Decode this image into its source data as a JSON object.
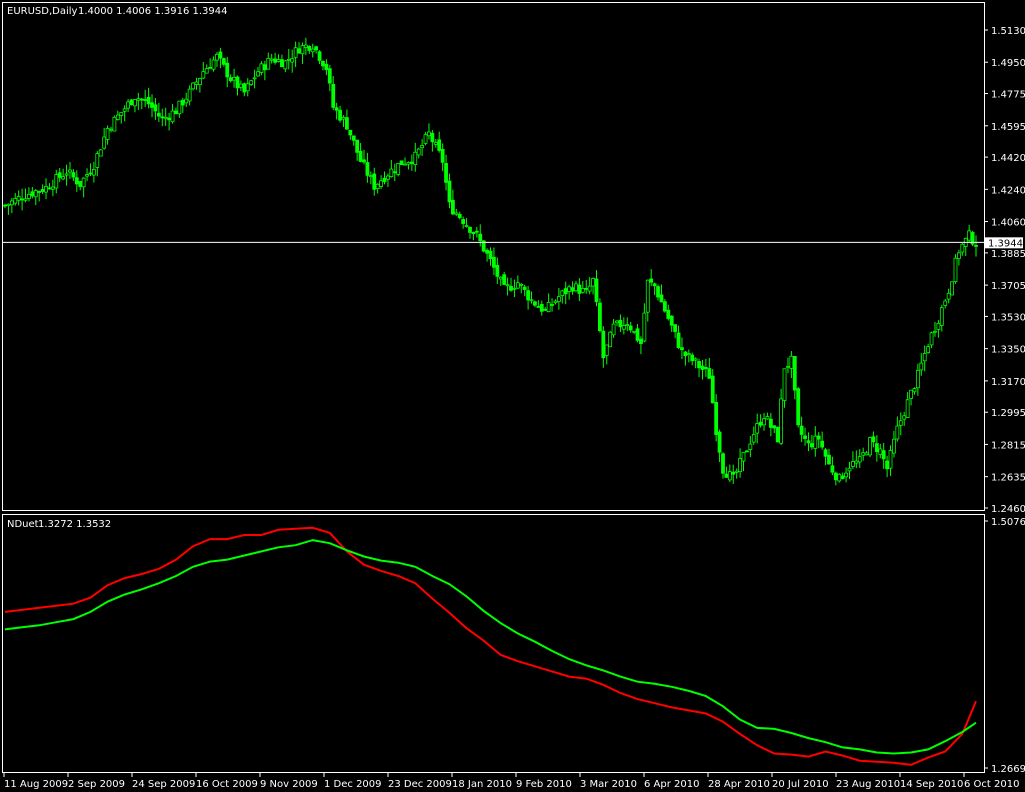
{
  "main_panel": {
    "header": {
      "symbol_tf": "EURUSD,Daily",
      "ohlc": "1.4000 1.4006 1.3916 1.3944"
    },
    "current_price_label": "1.3944"
  },
  "indicator_panel": {
    "header": {
      "name": "NDuet",
      "values": "1.3272 1.3532"
    }
  },
  "x_axis_labels": [
    "11 Aug 2009",
    "2 Sep 2009",
    "24 Sep 2009",
    "16 Oct 2009",
    "9 Nov 2009",
    "1 Dec 2009",
    "23 Dec 2009",
    "18 Jan 2010",
    "9 Feb 2010",
    "3 Mar 2010",
    "6 Apr 2010",
    "28 Apr 2010",
    "20 Jul 2010",
    "23 Aug 2010",
    "14 Sep 2010",
    "6 Oct 2010"
  ],
  "colors": {
    "background": "#000000",
    "candle": "#00ff00",
    "frame": "#ffffff",
    "fast_line": "#ff0000",
    "slow_line": "#00ff00"
  },
  "chart_data": [
    {
      "type": "candlestick",
      "title": "EURUSD,Daily",
      "y_ticks": [
        1.513,
        1.495,
        1.4775,
        1.4595,
        1.442,
        1.424,
        1.406,
        1.3885,
        1.3705,
        1.353,
        1.335,
        1.317,
        1.2995,
        1.2815,
        1.2635,
        1.246
      ],
      "ylim": [
        1.246,
        1.513
      ],
      "grid": false,
      "current_price": 1.3944,
      "close_path": [
        [
          0,
          1.415
        ],
        [
          6,
          1.421
        ],
        [
          12,
          1.425
        ],
        [
          18,
          1.434
        ],
        [
          22,
          1.427
        ],
        [
          26,
          1.438
        ],
        [
          30,
          1.458
        ],
        [
          34,
          1.467
        ],
        [
          38,
          1.476
        ],
        [
          42,
          1.472
        ],
        [
          46,
          1.463
        ],
        [
          50,
          1.468
        ],
        [
          54,
          1.478
        ],
        [
          58,
          1.49
        ],
        [
          62,
          1.498
        ],
        [
          66,
          1.486
        ],
        [
          70,
          1.478
        ],
        [
          74,
          1.49
        ],
        [
          78,
          1.497
        ],
        [
          82,
          1.495
        ],
        [
          86,
          1.503
        ],
        [
          90,
          1.505
        ],
        [
          94,
          1.492
        ],
        [
          96,
          1.47
        ],
        [
          100,
          1.46
        ],
        [
          104,
          1.44
        ],
        [
          108,
          1.426
        ],
        [
          112,
          1.433
        ],
        [
          116,
          1.439
        ],
        [
          120,
          1.442
        ],
        [
          124,
          1.455
        ],
        [
          128,
          1.44
        ],
        [
          130,
          1.415
        ],
        [
          134,
          1.407
        ],
        [
          138,
          1.398
        ],
        [
          142,
          1.384
        ],
        [
          146,
          1.368
        ],
        [
          150,
          1.372
        ],
        [
          154,
          1.362
        ],
        [
          158,
          1.356
        ],
        [
          162,
          1.364
        ],
        [
          166,
          1.37
        ],
        [
          170,
          1.366
        ],
        [
          172,
          1.373
        ],
        [
          175,
          1.33
        ],
        [
          178,
          1.347
        ],
        [
          182,
          1.35
        ],
        [
          186,
          1.338
        ],
        [
          188,
          1.372
        ],
        [
          190,
          1.37
        ],
        [
          194,
          1.352
        ],
        [
          198,
          1.333
        ],
        [
          202,
          1.327
        ],
        [
          206,
          1.32
        ],
        [
          208,
          1.29
        ],
        [
          210,
          1.268
        ],
        [
          213,
          1.262
        ],
        [
          216,
          1.275
        ],
        [
          219,
          1.288
        ],
        [
          222,
          1.298
        ],
        [
          226,
          1.285
        ],
        [
          228,
          1.325
        ],
        [
          230,
          1.328
        ],
        [
          232,
          1.29
        ],
        [
          235,
          1.281
        ],
        [
          238,
          1.285
        ],
        [
          241,
          1.27
        ],
        [
          244,
          1.262
        ],
        [
          247,
          1.27
        ],
        [
          250,
          1.272
        ],
        [
          253,
          1.283
        ],
        [
          256,
          1.278
        ],
        [
          258,
          1.268
        ],
        [
          261,
          1.29
        ],
        [
          264,
          1.305
        ],
        [
          267,
          1.32
        ],
        [
          270,
          1.338
        ],
        [
          273,
          1.352
        ],
        [
          276,
          1.368
        ],
        [
          279,
          1.39
        ],
        [
          282,
          1.398
        ],
        [
          284,
          1.394
        ]
      ]
    },
    {
      "type": "line",
      "title": "NDuet",
      "y_ticks": [
        1.5076,
        1.2669
      ],
      "ylim": [
        1.2669,
        1.5076
      ],
      "last_values": [
        1.3272,
        1.3532
      ],
      "series": [
        {
          "color": "#ff0000",
          "x": [
            0,
            5,
            10,
            15,
            20,
            25,
            30,
            35,
            40,
            45,
            50,
            55,
            60,
            65,
            70,
            75,
            80,
            85,
            90,
            95,
            100,
            105,
            110,
            115,
            120,
            125,
            130,
            135,
            140,
            145,
            150,
            155,
            160,
            165,
            170,
            175,
            180,
            185,
            190,
            195,
            200,
            205,
            210,
            215,
            220,
            225,
            230,
            235,
            240,
            245,
            250,
            255,
            260,
            265,
            270,
            275,
            280,
            284
          ],
          "values": [
            1.419,
            1.421,
            1.423,
            1.425,
            1.427,
            1.433,
            1.445,
            1.452,
            1.456,
            1.461,
            1.47,
            1.483,
            1.49,
            1.49,
            1.494,
            1.494,
            1.499,
            1.5,
            1.501,
            1.496,
            1.478,
            1.465,
            1.459,
            1.454,
            1.447,
            1.432,
            1.418,
            1.403,
            1.391,
            1.377,
            1.371,
            1.366,
            1.361,
            1.356,
            1.354,
            1.348,
            1.34,
            1.334,
            1.33,
            1.326,
            1.323,
            1.32,
            1.312,
            1.3,
            1.289,
            1.281,
            1.28,
            1.278,
            1.283,
            1.279,
            1.274,
            1.273,
            1.272,
            1.27,
            1.277,
            1.283,
            1.3,
            1.332
          ]
        },
        {
          "color": "#00ff00",
          "x": [
            0,
            5,
            10,
            15,
            20,
            25,
            30,
            35,
            40,
            45,
            50,
            55,
            60,
            65,
            70,
            75,
            80,
            85,
            90,
            95,
            100,
            105,
            110,
            115,
            120,
            125,
            130,
            135,
            140,
            145,
            150,
            155,
            160,
            165,
            170,
            175,
            180,
            185,
            190,
            195,
            200,
            205,
            210,
            215,
            220,
            225,
            230,
            235,
            240,
            245,
            250,
            255,
            260,
            265,
            270,
            275,
            280,
            284
          ],
          "values": [
            1.402,
            1.404,
            1.406,
            1.409,
            1.412,
            1.419,
            1.429,
            1.436,
            1.441,
            1.447,
            1.454,
            1.463,
            1.468,
            1.47,
            1.474,
            1.478,
            1.482,
            1.484,
            1.489,
            1.486,
            1.479,
            1.473,
            1.469,
            1.467,
            1.463,
            1.454,
            1.446,
            1.434,
            1.42,
            1.408,
            1.398,
            1.39,
            1.381,
            1.373,
            1.367,
            1.362,
            1.356,
            1.351,
            1.349,
            1.346,
            1.342,
            1.337,
            1.327,
            1.314,
            1.306,
            1.305,
            1.301,
            1.296,
            1.292,
            1.287,
            1.285,
            1.282,
            1.281,
            1.282,
            1.285,
            1.293,
            1.302,
            1.311
          ]
        }
      ]
    }
  ]
}
